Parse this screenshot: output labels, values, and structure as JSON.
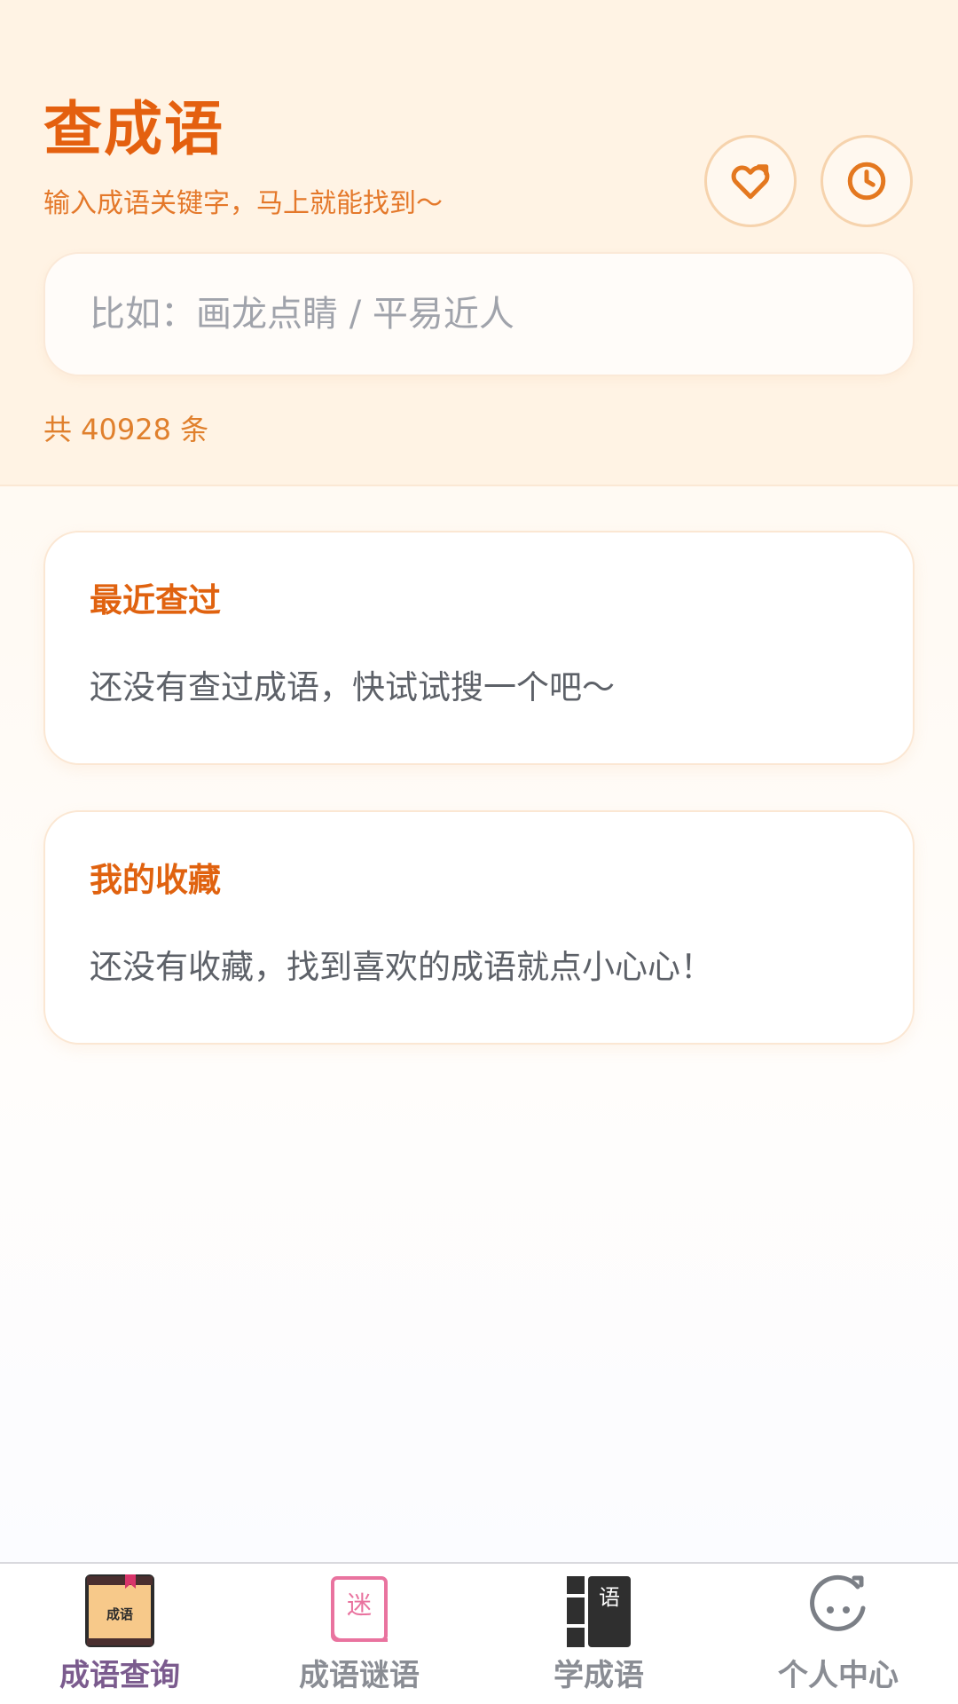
{
  "header": {
    "title": "查成语",
    "subtitle": "输入成语关键字，马上就能找到～",
    "favorite_icon": "heart-icon",
    "history_icon": "clock-icon"
  },
  "search": {
    "placeholder": "比如：画龙点睛 / 平易近人",
    "value": ""
  },
  "stats": {
    "total_label": "共 40928 条"
  },
  "recent": {
    "title": "最近查过",
    "empty_text": "还没有查过成语，快试试搜一个吧～"
  },
  "favorites": {
    "title": "我的收藏",
    "empty_text": "还没有收藏，找到喜欢的成语就点小心心！"
  },
  "tabbar": {
    "items": [
      {
        "label": "成语查询",
        "icon": "idiom-book-icon",
        "icon_text": "成语",
        "active": true
      },
      {
        "label": "成语谜语",
        "icon": "riddle-book-icon",
        "icon_text": "迷",
        "active": false
      },
      {
        "label": "学成语",
        "icon": "learn-book-icon",
        "icon_text": "语",
        "active": false
      },
      {
        "label": "个人中心",
        "icon": "profile-face-icon",
        "active": false
      }
    ]
  },
  "colors": {
    "accent": "#e4600f",
    "accent_light": "#e0802d",
    "header_bg": "#fff3e4",
    "active_tab": "#7b5b8e",
    "inactive_tab": "#8a8d94"
  }
}
